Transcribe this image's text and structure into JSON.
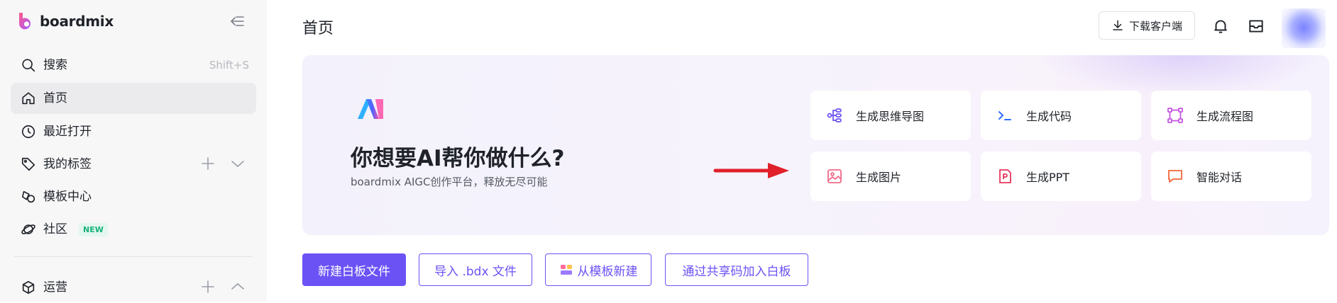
{
  "app": {
    "name": "boardmix",
    "brand_color": "#6b52f5"
  },
  "sidebar": {
    "search": {
      "label": "搜索",
      "shortcut": "Shift+S",
      "icon": "search-icon"
    },
    "items": [
      {
        "label": "首页",
        "icon": "home-icon",
        "active": true
      },
      {
        "label": "最近打开",
        "icon": "clock-icon"
      },
      {
        "label": "我的标签",
        "icon": "tag-icon"
      },
      {
        "label": "模板中心",
        "icon": "template-icon"
      },
      {
        "label": "社区",
        "icon": "planet-icon",
        "badge": "NEW"
      },
      {
        "label": "运营",
        "icon": "cube-icon"
      }
    ]
  },
  "header": {
    "title": "首页",
    "download_label": "下载客户端"
  },
  "ai_panel": {
    "heading": "你想要AI帮你做什么?",
    "subheading": "boardmix AIGC创作平台，释放无尽可能",
    "options": [
      {
        "label": "生成思维导图",
        "icon": "mindmap-icon"
      },
      {
        "label": "生成代码",
        "icon": "code-icon"
      },
      {
        "label": "生成流程图",
        "icon": "flowchart-icon"
      },
      {
        "label": "生成图片",
        "icon": "image-icon"
      },
      {
        "label": "生成PPT",
        "icon": "ppt-icon"
      },
      {
        "label": "智能对话",
        "icon": "chat-icon"
      }
    ]
  },
  "actions": {
    "new_whiteboard": "新建白板文件",
    "import_bdx": "导入 .bdx 文件",
    "from_template": "从模板新建",
    "join_by_code": "通过共享码加入白板"
  }
}
